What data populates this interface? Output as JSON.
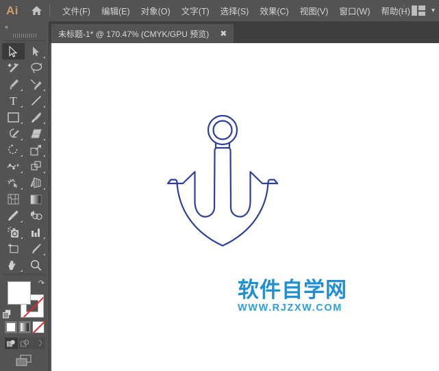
{
  "app": {
    "logo_text": "Ai",
    "home_icon": "home-icon",
    "workspace_icon": "workspace-switcher-icon",
    "chevron": "▾"
  },
  "menubar": {
    "items": [
      {
        "label": "文件(F)",
        "name": "menu-file"
      },
      {
        "label": "编辑(E)",
        "name": "menu-edit"
      },
      {
        "label": "对象(O)",
        "name": "menu-object"
      },
      {
        "label": "文字(T)",
        "name": "menu-type"
      },
      {
        "label": "选择(S)",
        "name": "menu-select"
      },
      {
        "label": "效果(C)",
        "name": "menu-effect"
      },
      {
        "label": "视图(V)",
        "name": "menu-view"
      },
      {
        "label": "窗口(W)",
        "name": "menu-window"
      },
      {
        "label": "帮助(H)",
        "name": "menu-help"
      }
    ]
  },
  "tabbar": {
    "document_title": "未标题-1* @ 170.47% (CMYK/GPU 预览)",
    "close_label": "✖"
  },
  "toolbar": {
    "collapse_label": "«",
    "tools": [
      {
        "name": "selection-tool",
        "selected": true,
        "corner": false
      },
      {
        "name": "direct-selection-tool",
        "selected": false,
        "corner": true
      },
      {
        "name": "magic-wand-tool",
        "selected": false,
        "corner": false
      },
      {
        "name": "lasso-tool",
        "selected": false,
        "corner": false
      },
      {
        "name": "pen-tool",
        "selected": false,
        "corner": true
      },
      {
        "name": "curvature-tool",
        "selected": false,
        "corner": true
      },
      {
        "name": "type-tool",
        "selected": false,
        "corner": true
      },
      {
        "name": "line-segment-tool",
        "selected": false,
        "corner": true
      },
      {
        "name": "rectangle-tool",
        "selected": false,
        "corner": true
      },
      {
        "name": "paintbrush-tool",
        "selected": false,
        "corner": true
      },
      {
        "name": "shaper-tool",
        "selected": false,
        "corner": true
      },
      {
        "name": "eraser-tool",
        "selected": false,
        "corner": true
      },
      {
        "name": "rotate-tool",
        "selected": false,
        "corner": true
      },
      {
        "name": "scale-tool",
        "selected": false,
        "corner": true
      },
      {
        "name": "width-tool",
        "selected": false,
        "corner": true
      },
      {
        "name": "free-transform-tool",
        "selected": false,
        "corner": true
      },
      {
        "name": "shape-builder-tool",
        "selected": false,
        "corner": true
      },
      {
        "name": "perspective-grid-tool",
        "selected": false,
        "corner": true
      },
      {
        "name": "mesh-tool",
        "selected": false,
        "corner": false
      },
      {
        "name": "gradient-tool",
        "selected": false,
        "corner": false
      },
      {
        "name": "eyedropper-tool",
        "selected": false,
        "corner": true
      },
      {
        "name": "blend-tool",
        "selected": false,
        "corner": false
      },
      {
        "name": "symbol-sprayer-tool",
        "selected": false,
        "corner": true
      },
      {
        "name": "column-graph-tool",
        "selected": false,
        "corner": true
      },
      {
        "name": "artboard-tool",
        "selected": false,
        "corner": false
      },
      {
        "name": "slice-tool",
        "selected": false,
        "corner": true
      },
      {
        "name": "hand-tool",
        "selected": false,
        "corner": true
      },
      {
        "name": "zoom-tool",
        "selected": false,
        "corner": false
      }
    ],
    "colors": {
      "fill": "#ffffff",
      "stroke": "#ffffff",
      "none_slash": "#e4282a"
    },
    "swap_icon": "swap-fill-stroke-icon",
    "default_icon": "default-fill-stroke-icon",
    "paint_modes": [
      "color-swatch",
      "gradient-swatch",
      "none-swatch"
    ],
    "draw_modes": [
      "draw-normal",
      "draw-behind",
      "draw-inside"
    ],
    "screen_mode_icon": "screen-mode-icon"
  },
  "canvas": {
    "background": "#ffffff",
    "artwork": {
      "name": "anchor-illustration",
      "stroke_color": "#2a3f9d",
      "fill": "none"
    },
    "watermark": {
      "chinese": "软件自学网",
      "url": "WWW.RJZXW.COM",
      "color_cn": "#1f8fd4",
      "color_en": "#2d9ee0"
    }
  }
}
